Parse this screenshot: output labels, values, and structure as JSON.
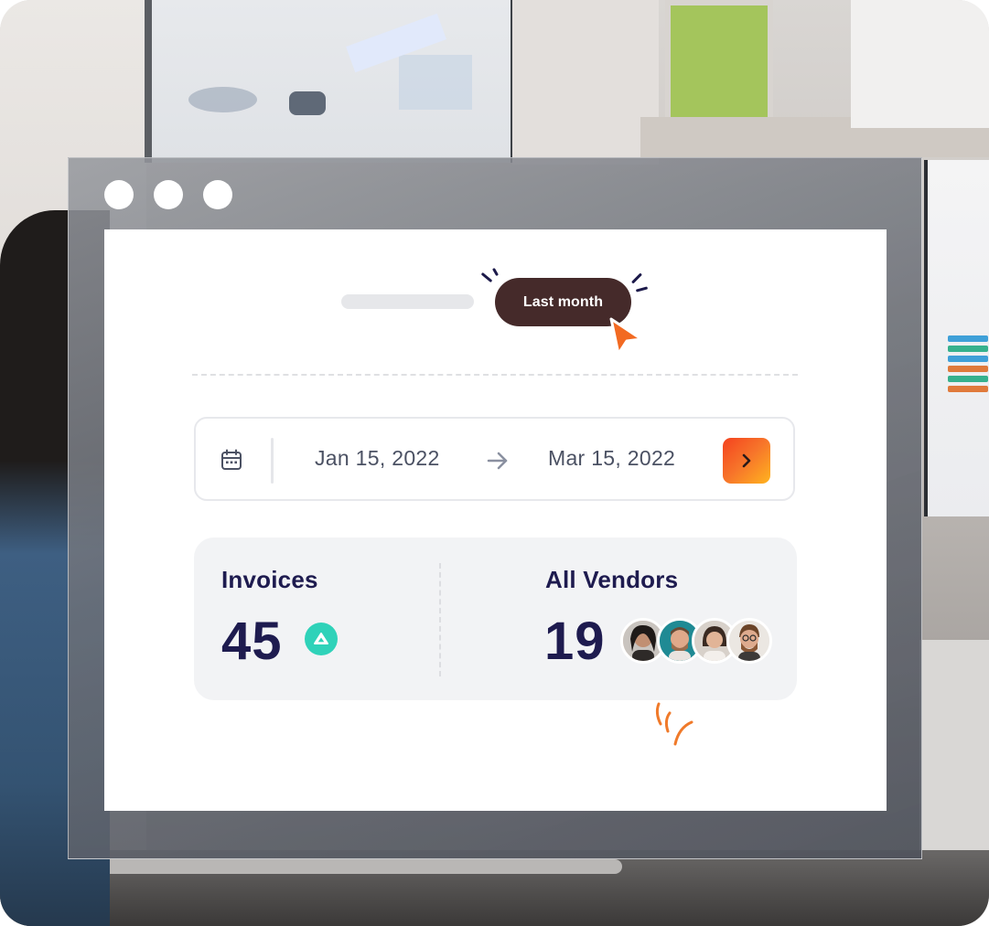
{
  "filter": {
    "selected_period": "Last month"
  },
  "date_range": {
    "start": "Jan 15, 2022",
    "end": "Mar 15, 2022"
  },
  "stats": {
    "invoices": {
      "label": "Invoices",
      "value": "45",
      "trend": "up"
    },
    "vendors": {
      "label": "All Vendors",
      "value": "19",
      "avatar_count": 4
    }
  },
  "colors": {
    "pill": "#452a2a",
    "accent_orange": "#f7762a",
    "trend_up": "#2fd2b9",
    "heading": "#1e1b4f"
  },
  "icons": {
    "calendar": "calendar-icon",
    "arrow": "arrow-right-icon",
    "next": "chevron-right-icon",
    "trend": "triangle-up-icon",
    "cursor": "mouse-cursor-icon"
  }
}
